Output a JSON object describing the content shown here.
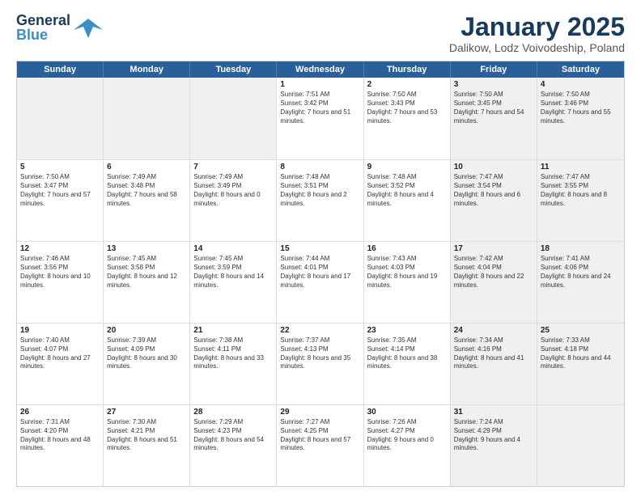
{
  "logo": {
    "line1": "General",
    "line2": "Blue"
  },
  "title": "January 2025",
  "subtitle": "Dalikow, Lodz Voivodeship, Poland",
  "header_days": [
    "Sunday",
    "Monday",
    "Tuesday",
    "Wednesday",
    "Thursday",
    "Friday",
    "Saturday"
  ],
  "weeks": [
    [
      {
        "day": "",
        "sunrise": "",
        "sunset": "",
        "daylight": "",
        "shaded": true
      },
      {
        "day": "",
        "sunrise": "",
        "sunset": "",
        "daylight": "",
        "shaded": true
      },
      {
        "day": "",
        "sunrise": "",
        "sunset": "",
        "daylight": "",
        "shaded": true
      },
      {
        "day": "1",
        "sunrise": "Sunrise: 7:51 AM",
        "sunset": "Sunset: 3:42 PM",
        "daylight": "Daylight: 7 hours and 51 minutes.",
        "shaded": false
      },
      {
        "day": "2",
        "sunrise": "Sunrise: 7:50 AM",
        "sunset": "Sunset: 3:43 PM",
        "daylight": "Daylight: 7 hours and 53 minutes.",
        "shaded": false
      },
      {
        "day": "3",
        "sunrise": "Sunrise: 7:50 AM",
        "sunset": "Sunset: 3:45 PM",
        "daylight": "Daylight: 7 hours and 54 minutes.",
        "shaded": true
      },
      {
        "day": "4",
        "sunrise": "Sunrise: 7:50 AM",
        "sunset": "Sunset: 3:46 PM",
        "daylight": "Daylight: 7 hours and 55 minutes.",
        "shaded": true
      }
    ],
    [
      {
        "day": "5",
        "sunrise": "Sunrise: 7:50 AM",
        "sunset": "Sunset: 3:47 PM",
        "daylight": "Daylight: 7 hours and 57 minutes.",
        "shaded": false
      },
      {
        "day": "6",
        "sunrise": "Sunrise: 7:49 AM",
        "sunset": "Sunset: 3:48 PM",
        "daylight": "Daylight: 7 hours and 58 minutes.",
        "shaded": false
      },
      {
        "day": "7",
        "sunrise": "Sunrise: 7:49 AM",
        "sunset": "Sunset: 3:49 PM",
        "daylight": "Daylight: 8 hours and 0 minutes.",
        "shaded": false
      },
      {
        "day": "8",
        "sunrise": "Sunrise: 7:48 AM",
        "sunset": "Sunset: 3:51 PM",
        "daylight": "Daylight: 8 hours and 2 minutes.",
        "shaded": false
      },
      {
        "day": "9",
        "sunrise": "Sunrise: 7:48 AM",
        "sunset": "Sunset: 3:52 PM",
        "daylight": "Daylight: 8 hours and 4 minutes.",
        "shaded": false
      },
      {
        "day": "10",
        "sunrise": "Sunrise: 7:47 AM",
        "sunset": "Sunset: 3:54 PM",
        "daylight": "Daylight: 8 hours and 6 minutes.",
        "shaded": true
      },
      {
        "day": "11",
        "sunrise": "Sunrise: 7:47 AM",
        "sunset": "Sunset: 3:55 PM",
        "daylight": "Daylight: 8 hours and 8 minutes.",
        "shaded": true
      }
    ],
    [
      {
        "day": "12",
        "sunrise": "Sunrise: 7:46 AM",
        "sunset": "Sunset: 3:56 PM",
        "daylight": "Daylight: 8 hours and 10 minutes.",
        "shaded": false
      },
      {
        "day": "13",
        "sunrise": "Sunrise: 7:45 AM",
        "sunset": "Sunset: 3:58 PM",
        "daylight": "Daylight: 8 hours and 12 minutes.",
        "shaded": false
      },
      {
        "day": "14",
        "sunrise": "Sunrise: 7:45 AM",
        "sunset": "Sunset: 3:59 PM",
        "daylight": "Daylight: 8 hours and 14 minutes.",
        "shaded": false
      },
      {
        "day": "15",
        "sunrise": "Sunrise: 7:44 AM",
        "sunset": "Sunset: 4:01 PM",
        "daylight": "Daylight: 8 hours and 17 minutes.",
        "shaded": false
      },
      {
        "day": "16",
        "sunrise": "Sunrise: 7:43 AM",
        "sunset": "Sunset: 4:03 PM",
        "daylight": "Daylight: 8 hours and 19 minutes.",
        "shaded": false
      },
      {
        "day": "17",
        "sunrise": "Sunrise: 7:42 AM",
        "sunset": "Sunset: 4:04 PM",
        "daylight": "Daylight: 8 hours and 22 minutes.",
        "shaded": true
      },
      {
        "day": "18",
        "sunrise": "Sunrise: 7:41 AM",
        "sunset": "Sunset: 4:06 PM",
        "daylight": "Daylight: 8 hours and 24 minutes.",
        "shaded": true
      }
    ],
    [
      {
        "day": "19",
        "sunrise": "Sunrise: 7:40 AM",
        "sunset": "Sunset: 4:07 PM",
        "daylight": "Daylight: 8 hours and 27 minutes.",
        "shaded": false
      },
      {
        "day": "20",
        "sunrise": "Sunrise: 7:39 AM",
        "sunset": "Sunset: 4:09 PM",
        "daylight": "Daylight: 8 hours and 30 minutes.",
        "shaded": false
      },
      {
        "day": "21",
        "sunrise": "Sunrise: 7:38 AM",
        "sunset": "Sunset: 4:11 PM",
        "daylight": "Daylight: 8 hours and 33 minutes.",
        "shaded": false
      },
      {
        "day": "22",
        "sunrise": "Sunrise: 7:37 AM",
        "sunset": "Sunset: 4:13 PM",
        "daylight": "Daylight: 8 hours and 35 minutes.",
        "shaded": false
      },
      {
        "day": "23",
        "sunrise": "Sunrise: 7:35 AM",
        "sunset": "Sunset: 4:14 PM",
        "daylight": "Daylight: 8 hours and 38 minutes.",
        "shaded": false
      },
      {
        "day": "24",
        "sunrise": "Sunrise: 7:34 AM",
        "sunset": "Sunset: 4:16 PM",
        "daylight": "Daylight: 8 hours and 41 minutes.",
        "shaded": true
      },
      {
        "day": "25",
        "sunrise": "Sunrise: 7:33 AM",
        "sunset": "Sunset: 4:18 PM",
        "daylight": "Daylight: 8 hours and 44 minutes.",
        "shaded": true
      }
    ],
    [
      {
        "day": "26",
        "sunrise": "Sunrise: 7:31 AM",
        "sunset": "Sunset: 4:20 PM",
        "daylight": "Daylight: 8 hours and 48 minutes.",
        "shaded": false
      },
      {
        "day": "27",
        "sunrise": "Sunrise: 7:30 AM",
        "sunset": "Sunset: 4:21 PM",
        "daylight": "Daylight: 8 hours and 51 minutes.",
        "shaded": false
      },
      {
        "day": "28",
        "sunrise": "Sunrise: 7:29 AM",
        "sunset": "Sunset: 4:23 PM",
        "daylight": "Daylight: 8 hours and 54 minutes.",
        "shaded": false
      },
      {
        "day": "29",
        "sunrise": "Sunrise: 7:27 AM",
        "sunset": "Sunset: 4:25 PM",
        "daylight": "Daylight: 8 hours and 57 minutes.",
        "shaded": false
      },
      {
        "day": "30",
        "sunrise": "Sunrise: 7:26 AM",
        "sunset": "Sunset: 4:27 PM",
        "daylight": "Daylight: 9 hours and 0 minutes.",
        "shaded": false
      },
      {
        "day": "31",
        "sunrise": "Sunrise: 7:24 AM",
        "sunset": "Sunset: 4:29 PM",
        "daylight": "Daylight: 9 hours and 4 minutes.",
        "shaded": true
      },
      {
        "day": "",
        "sunrise": "",
        "sunset": "",
        "daylight": "",
        "shaded": true
      }
    ]
  ]
}
